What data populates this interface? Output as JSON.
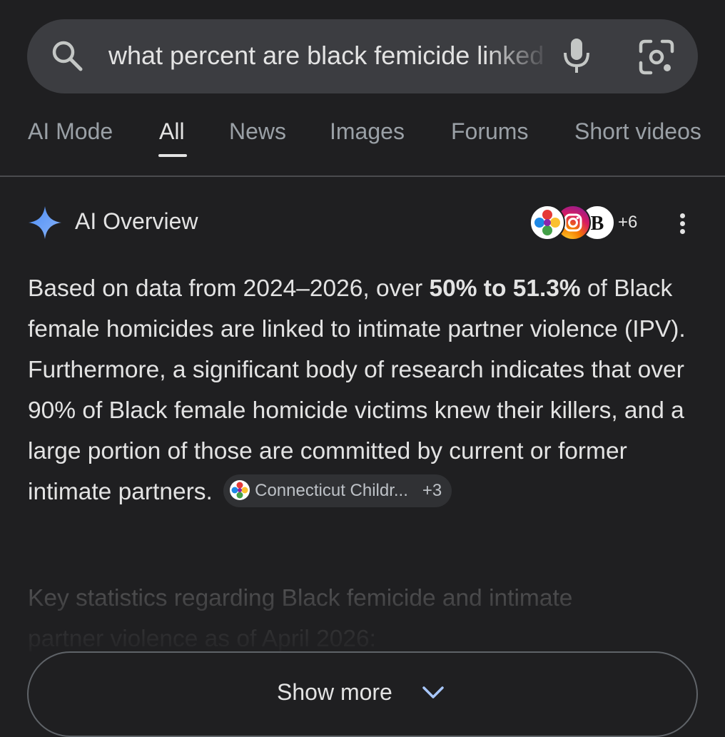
{
  "search": {
    "query": "what percent are black femicide linked to intimate partner violence",
    "icons": [
      "search-icon",
      "mic-icon",
      "google-lens-icon"
    ]
  },
  "tabs": [
    {
      "label": "AI Mode",
      "active": false
    },
    {
      "label": "All",
      "active": true
    },
    {
      "label": "News",
      "active": false
    },
    {
      "label": "Images",
      "active": false
    },
    {
      "label": "Forums",
      "active": false
    },
    {
      "label": "Short videos",
      "active": false
    }
  ],
  "ai_overview": {
    "title": "AI Overview",
    "sources_extra_count": "+6",
    "source_icons": [
      "multicolor-logo-icon",
      "instagram-icon",
      "b-letter-logo-icon"
    ],
    "answer": {
      "part1": "Based on data from 2024–2026, over ",
      "bold": "50% to 51.3%",
      "part2": " of Black female homicides are linked to intimate partner violence (IPV). Furthermore, a significant body of research indicates that over 90% of Black female homicide victims knew their killers, and a large portion of those are committed by current or former intimate partners. "
    },
    "citation": {
      "label": "Connecticut Childr...",
      "extra": "+3"
    },
    "faded_line1": "Key statistics regarding Black femicide and intimate",
    "faded_line2": "partner violence as of April 2026:",
    "show_more_label": "Show more"
  },
  "colors": {
    "background": "#1f1f21",
    "search_bar": "#3c3d41",
    "text_primary": "#e3e3e3",
    "text_secondary": "#9aa0a6",
    "chevron": "#a8c7fa"
  }
}
